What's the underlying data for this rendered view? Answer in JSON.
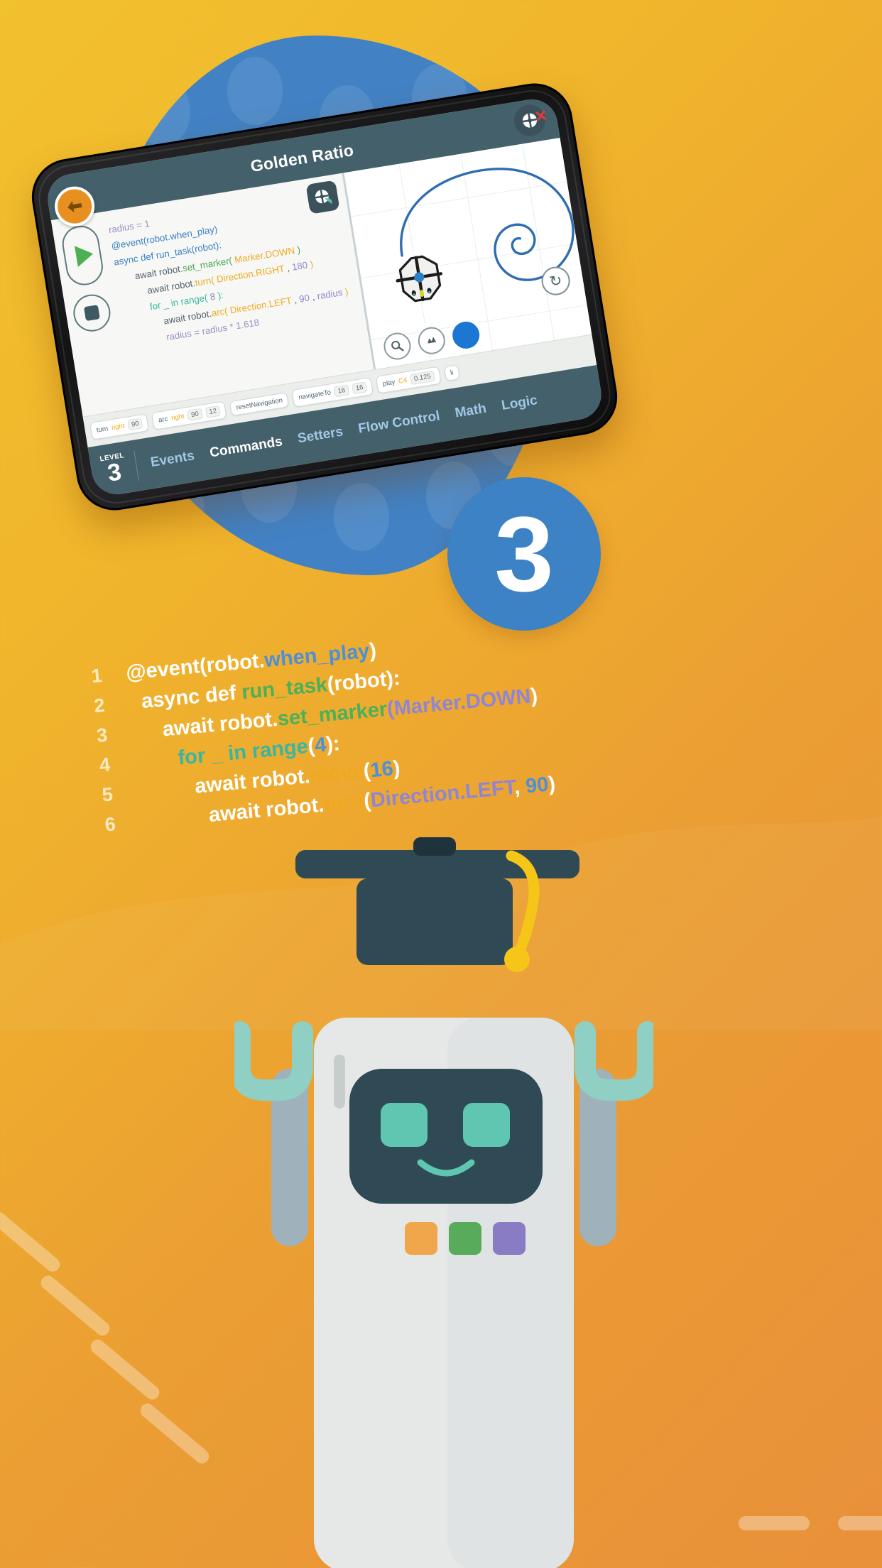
{
  "poster": {
    "level_badge_number": "3",
    "background_accent": "#3d82c4",
    "background_color_start": "#f2c12e",
    "background_color_end": "#e8903a"
  },
  "tablet_app": {
    "header": {
      "title": "Golden Ratio",
      "back_icon": "back-arrow-icon",
      "connection_icon": "robot-connection-icon",
      "disconnected_mark": "✕"
    },
    "controls": {
      "run_icon": "play-icon",
      "stop_icon": "stop-icon"
    },
    "code_lines": [
      {
        "indent": 0,
        "tokens": [
          {
            "t": "radius = 1",
            "c": "c-var"
          }
        ]
      },
      {
        "indent": 0,
        "tokens": [
          {
            "t": "@event(robot.when_play)",
            "c": "c-dec"
          }
        ]
      },
      {
        "indent": 0,
        "tokens": [
          {
            "t": "async def run_task(robot):",
            "c": "c-kw"
          }
        ]
      },
      {
        "indent": 1,
        "tokens": [
          {
            "t": "await robot.",
            "c": "c-dark"
          },
          {
            "t": "set_marker(",
            "c": "c-green"
          },
          {
            "t": " Marker.DOWN ",
            "c": "c-or"
          },
          {
            "t": ")",
            "c": "c-green"
          }
        ]
      },
      {
        "indent": 2,
        "tokens": [
          {
            "t": "await robot.",
            "c": "c-dark"
          },
          {
            "t": "turn(",
            "c": "c-amber"
          },
          {
            "t": " Direction.RIGHT ",
            "c": "c-or"
          },
          {
            "t": ", ",
            "c": "c-dark"
          },
          {
            "t": "180",
            "c": "c-num"
          },
          {
            "t": " )",
            "c": "c-amber"
          }
        ]
      },
      {
        "indent": 2,
        "tokens": [
          {
            "t": "for ",
            "c": "c-teal"
          },
          {
            "t": "_ in range(",
            "c": "c-teal"
          },
          {
            "t": " 8 ",
            "c": "c-num"
          },
          {
            "t": "):",
            "c": "c-teal"
          }
        ]
      },
      {
        "indent": 3,
        "tokens": [
          {
            "t": "await robot.",
            "c": "c-dark"
          },
          {
            "t": "arc(",
            "c": "c-amber"
          },
          {
            "t": " Direction.LEFT ",
            "c": "c-or"
          },
          {
            "t": ", ",
            "c": "c-dark"
          },
          {
            "t": "90",
            "c": "c-num"
          },
          {
            "t": " , ",
            "c": "c-dark"
          },
          {
            "t": "radius",
            "c": "c-num"
          },
          {
            "t": " )",
            "c": "c-amber"
          }
        ]
      },
      {
        "indent": 3,
        "tokens": [
          {
            "t": "radius =  radius * 1.618",
            "c": "c-var"
          }
        ]
      }
    ],
    "canvas": {
      "robot_icon": "robot-top-view-icon",
      "drawn_path": "golden-spiral",
      "refresh_icon": "↻",
      "tools": [
        {
          "name": "zoom-tool",
          "glyph": "⌕"
        },
        {
          "name": "pan-tool",
          "glyph": "✥"
        },
        {
          "name": "marker-color-tool",
          "glyph": ""
        }
      ],
      "network_badge_icon": "robot-network-icon"
    },
    "palette_blocks": [
      {
        "name": "turn",
        "args": [
          "right",
          "90"
        ]
      },
      {
        "name": "arc",
        "args": [
          "right",
          "90",
          "12"
        ]
      },
      {
        "name": "resetNavigation",
        "args": []
      },
      {
        "name": "navigateTo",
        "args": [
          "16",
          "16"
        ]
      },
      {
        "name": "play",
        "args": [
          "C4",
          "0.125"
        ]
      },
      {
        "name": "li",
        "args": []
      }
    ],
    "level_label": "LEVEL",
    "level_number": "3",
    "tabs": [
      {
        "label": "Events",
        "selected": false
      },
      {
        "label": "Commands",
        "selected": true
      },
      {
        "label": "Setters",
        "selected": false
      },
      {
        "label": "Flow Control",
        "selected": false
      },
      {
        "label": "Math",
        "selected": false
      },
      {
        "label": "Logic",
        "selected": false
      }
    ]
  },
  "featured_code": {
    "lines": [
      {
        "num": "1",
        "indent": "b1",
        "tokens": [
          {
            "t": "@event(robot.",
            "c": "w"
          },
          {
            "t": "when_play",
            "c": "blu"
          },
          {
            "t": ")",
            "c": "w"
          }
        ]
      },
      {
        "num": "2",
        "indent": "b2",
        "tokens": [
          {
            "t": "async def ",
            "c": "w"
          },
          {
            "t": "run_task",
            "c": "grn"
          },
          {
            "t": "(robot):",
            "c": "w"
          }
        ]
      },
      {
        "num": "3",
        "indent": "b3",
        "tokens": [
          {
            "t": "await robot.",
            "c": "w"
          },
          {
            "t": "set_marker",
            "c": "grn"
          },
          {
            "t": "(",
            "c": "pur"
          },
          {
            "t": "Marker.DOWN",
            "c": "pur"
          },
          {
            "t": ")",
            "c": "w"
          }
        ]
      },
      {
        "num": "4",
        "indent": "b4",
        "tokens": [
          {
            "t": "for _ in range",
            "c": "cyn"
          },
          {
            "t": "(",
            "c": "w"
          },
          {
            "t": "4",
            "c": "blu"
          },
          {
            "t": "):",
            "c": "w"
          }
        ]
      },
      {
        "num": "5",
        "indent": "b5",
        "tokens": [
          {
            "t": "await robot.",
            "c": "w"
          },
          {
            "t": "move",
            "c": "ora"
          },
          {
            "t": "(",
            "c": "w"
          },
          {
            "t": "16",
            "c": "blu"
          },
          {
            "t": ")",
            "c": "w"
          }
        ]
      },
      {
        "num": "6",
        "indent": "b6",
        "tokens": [
          {
            "t": "await robot.",
            "c": "w"
          },
          {
            "t": "turn",
            "c": "ora"
          },
          {
            "t": "(",
            "c": "w"
          },
          {
            "t": "Direction.LEFT",
            "c": "pur"
          },
          {
            "t": ", ",
            "c": "w"
          },
          {
            "t": "90",
            "c": "blu"
          },
          {
            "t": ")",
            "c": "w"
          }
        ]
      }
    ]
  },
  "robot_character": {
    "name": "graduate-robot",
    "cap_color": "#2f4a55",
    "tassel_color": "#f5c518",
    "body_color": "#e6e8e8",
    "face_color": "#2f4a55",
    "eye_color": "#5ec6b1",
    "arm_color": "#9fb2bc",
    "hand_color": "#8fcfc4",
    "button_colors": [
      "#f0a64a",
      "#58ab5a",
      "#8a7cc4"
    ]
  }
}
